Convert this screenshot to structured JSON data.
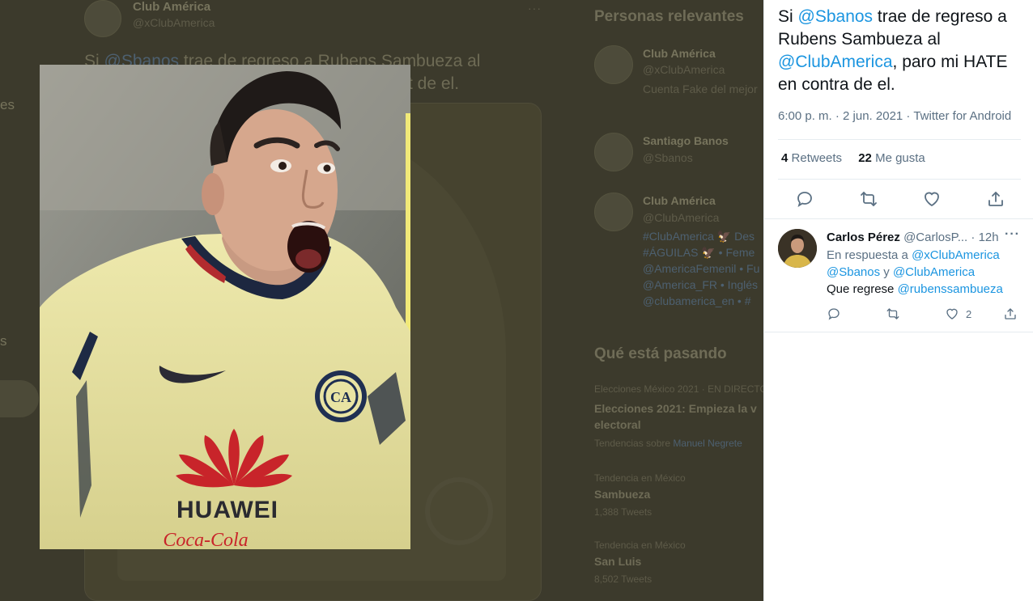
{
  "background": {
    "nav_fragments": [
      "es",
      "s"
    ],
    "tweet": {
      "author_name": "Club América",
      "author_handle": "@xClubAmerica",
      "text_prefix": "Si ",
      "mention": "@Sbanos",
      "text_rest": " trae de regreso a Rubens Sambueza al",
      "text_line2_tail": "t de el.",
      "more": "···"
    },
    "relevant_people": {
      "heading": "Personas relevantes",
      "people": [
        {
          "name": "Club América",
          "handle": "@xClubAmerica",
          "bio": "Cuenta Fake del mejor"
        },
        {
          "name": "Santiago Banos",
          "handle": "@Sbanos"
        },
        {
          "name": "Club América",
          "handle": "@ClubAmerica",
          "bio_lines": [
            "#ClubAmerica 🦅 Des",
            "#ÁGUILAS 🦅 • Feme",
            "@AmericaFemenil • Fu",
            "@America_FR • Inglés",
            "@clubamerica_en • #"
          ]
        }
      ]
    },
    "whats_happening": {
      "heading": "Qué está pasando",
      "items": [
        {
          "context": "Elecciones México 2021 · EN DIRECTO",
          "title_lines": [
            "Elecciones 2021: Empieza la v",
            "electoral"
          ],
          "sub_prefix": "Tendencias sobre ",
          "sub_link": "Manuel Negrete"
        },
        {
          "context": "Tendencia en México",
          "title": "Sambueza",
          "count": "1,388 Tweets"
        },
        {
          "context": "Tendencia en México",
          "title": "San Luis",
          "count": "8,502 Tweets"
        }
      ]
    }
  },
  "photo": {
    "sponsor_main": "HUAWEI",
    "sponsor_sub": "Coca-Cola",
    "crest": "CA"
  },
  "tweet": {
    "text_parts": [
      {
        "text": "Si ",
        "link": false
      },
      {
        "text": "@Sbanos",
        "link": true
      },
      {
        "text": " trae de regreso a Rubens Sambueza al ",
        "link": false
      },
      {
        "text": "@ClubAmerica",
        "link": true
      },
      {
        "text": ", paro mi HATE en contra de el.",
        "link": false
      }
    ],
    "timestamp": "6:00 p. m. · 2 jun. 2021 · Twitter for Android",
    "retweets_count": "4",
    "retweets_label": "Retweets",
    "likes_count": "22",
    "likes_label": "Me gusta",
    "actions": [
      "reply-icon",
      "retweet-icon",
      "like-icon",
      "share-icon"
    ]
  },
  "reply": {
    "name": "Carlos Pérez",
    "handle": "@CarlosP...",
    "time": "12h",
    "more": "···",
    "in_reply_to_label": "En respuesta a",
    "in_reply_to_1": "@xClubAmerica",
    "in_reply_to_2": "@Sbanos",
    "in_reply_to_sep": "y",
    "in_reply_to_3": "@ClubAmerica",
    "body_prefix": "Que regrese",
    "body_mention": "@rubenssambueza",
    "like_count": "2"
  },
  "colors": {
    "link": "#1b95e0",
    "text": "#0f1419",
    "secondary": "#5b7083",
    "jersey_yellow": "#e9e4a3",
    "overlay": "#3c3a2c"
  }
}
